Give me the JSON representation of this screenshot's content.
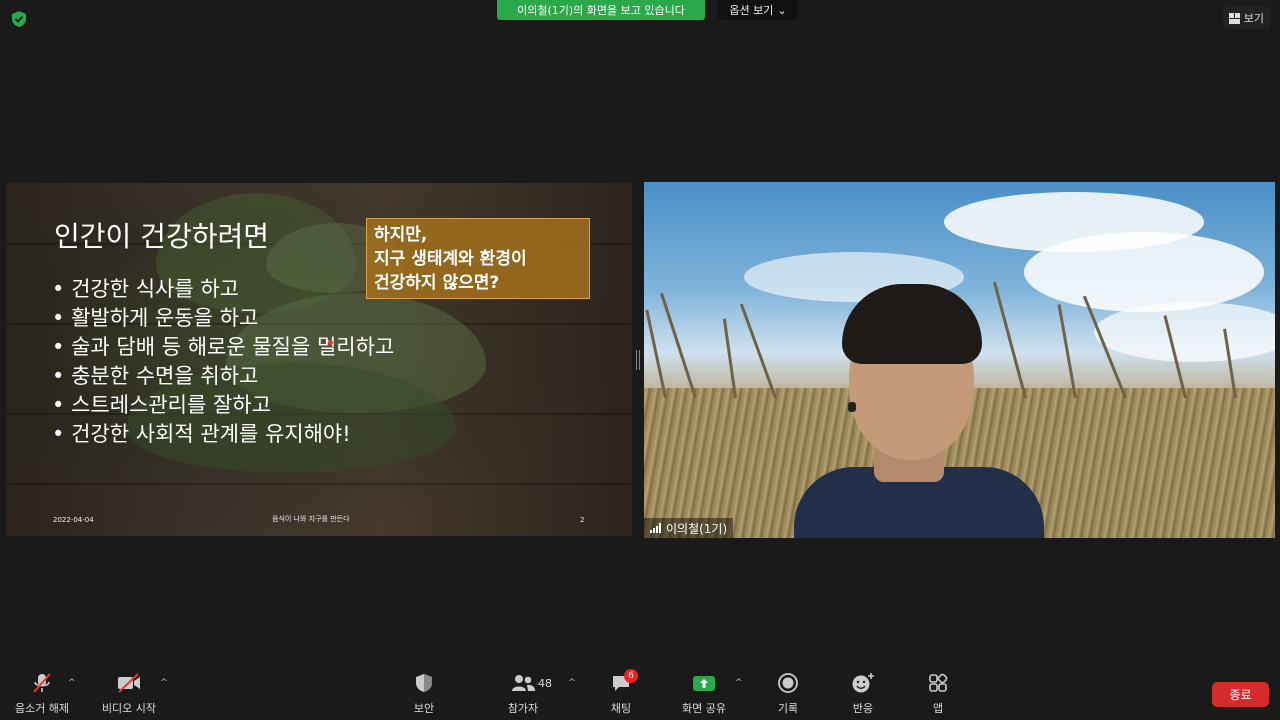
{
  "top": {
    "share_banner": "이의철(1기)의 화면을 보고 있습니다",
    "options_label": "옵션 보기",
    "view_label": "보기"
  },
  "slide": {
    "title": "인간이 건강하려면",
    "bullets": [
      "건강한 식사를 하고",
      "활발하게 운동을 하고",
      "술과 담배 등 해로운 물질을 멀리하고",
      "충분한 수면을 취하고",
      "스트레스관리를 잘하고",
      "건강한 사회적 관계를 유지해야!"
    ],
    "callout": [
      "하지만,",
      "지구 생태계와 환경이",
      "건강하지 않으면?"
    ],
    "footer_date": "2022-04-04",
    "footer_title": "음식이 나와 지구를 만든다",
    "footer_page": "2"
  },
  "camera": {
    "participant_name": "이의철(1기)"
  },
  "toolbar": {
    "unmute": "음소거 해제",
    "start_video": "비디오 시작",
    "security": "보안",
    "participants": "참가자",
    "participants_count": "48",
    "chat": "채팅",
    "chat_badge": "6",
    "share_screen": "화면 공유",
    "record": "기록",
    "reactions": "반응",
    "apps": "앱",
    "end": "종료"
  },
  "colors": {
    "share_green": "#2aa84a",
    "end_red": "#d52b2b",
    "callout_gold": "#a06e1e"
  }
}
